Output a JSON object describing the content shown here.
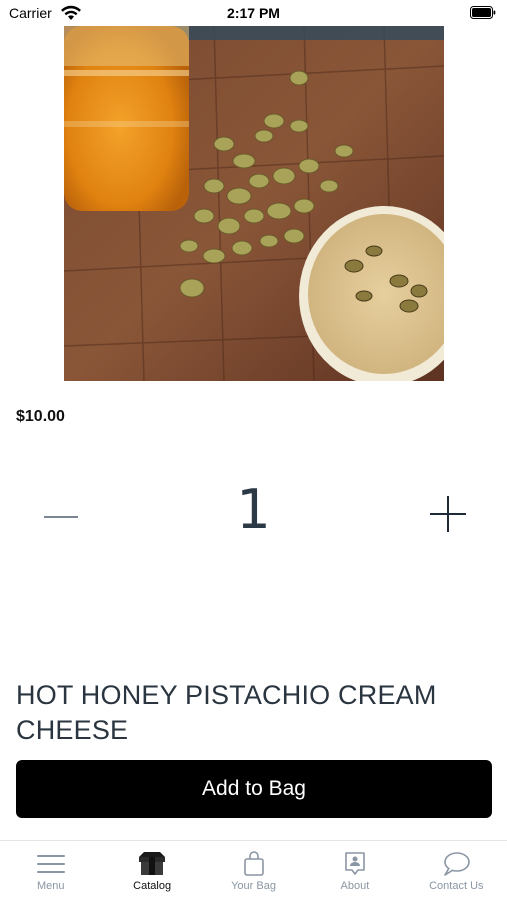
{
  "status_bar": {
    "carrier": "Carrier",
    "time": "2:17 PM"
  },
  "product": {
    "price": "$10.00",
    "quantity": "1",
    "title": "HOT HONEY PISTACHIO CREAM CHEESE",
    "image_icon": "product-photo-honey-pistachio-cream-cheese"
  },
  "actions": {
    "add_to_bag_label": "Add to Bag"
  },
  "tab_bar": {
    "items": [
      {
        "label": "Menu",
        "icon": "menu-icon",
        "active": false
      },
      {
        "label": "Catalog",
        "icon": "catalog-box-icon",
        "active": true
      },
      {
        "label": "Your Bag",
        "icon": "shopping-bag-icon",
        "active": false
      },
      {
        "label": "About",
        "icon": "about-badge-icon",
        "active": false
      },
      {
        "label": "Contact Us",
        "icon": "chat-bubble-icon",
        "active": false
      }
    ]
  },
  "colors": {
    "button_bg": "#000000",
    "tab_inactive": "#8a96a3",
    "tab_active": "#111111",
    "title_text": "#2a3540"
  }
}
